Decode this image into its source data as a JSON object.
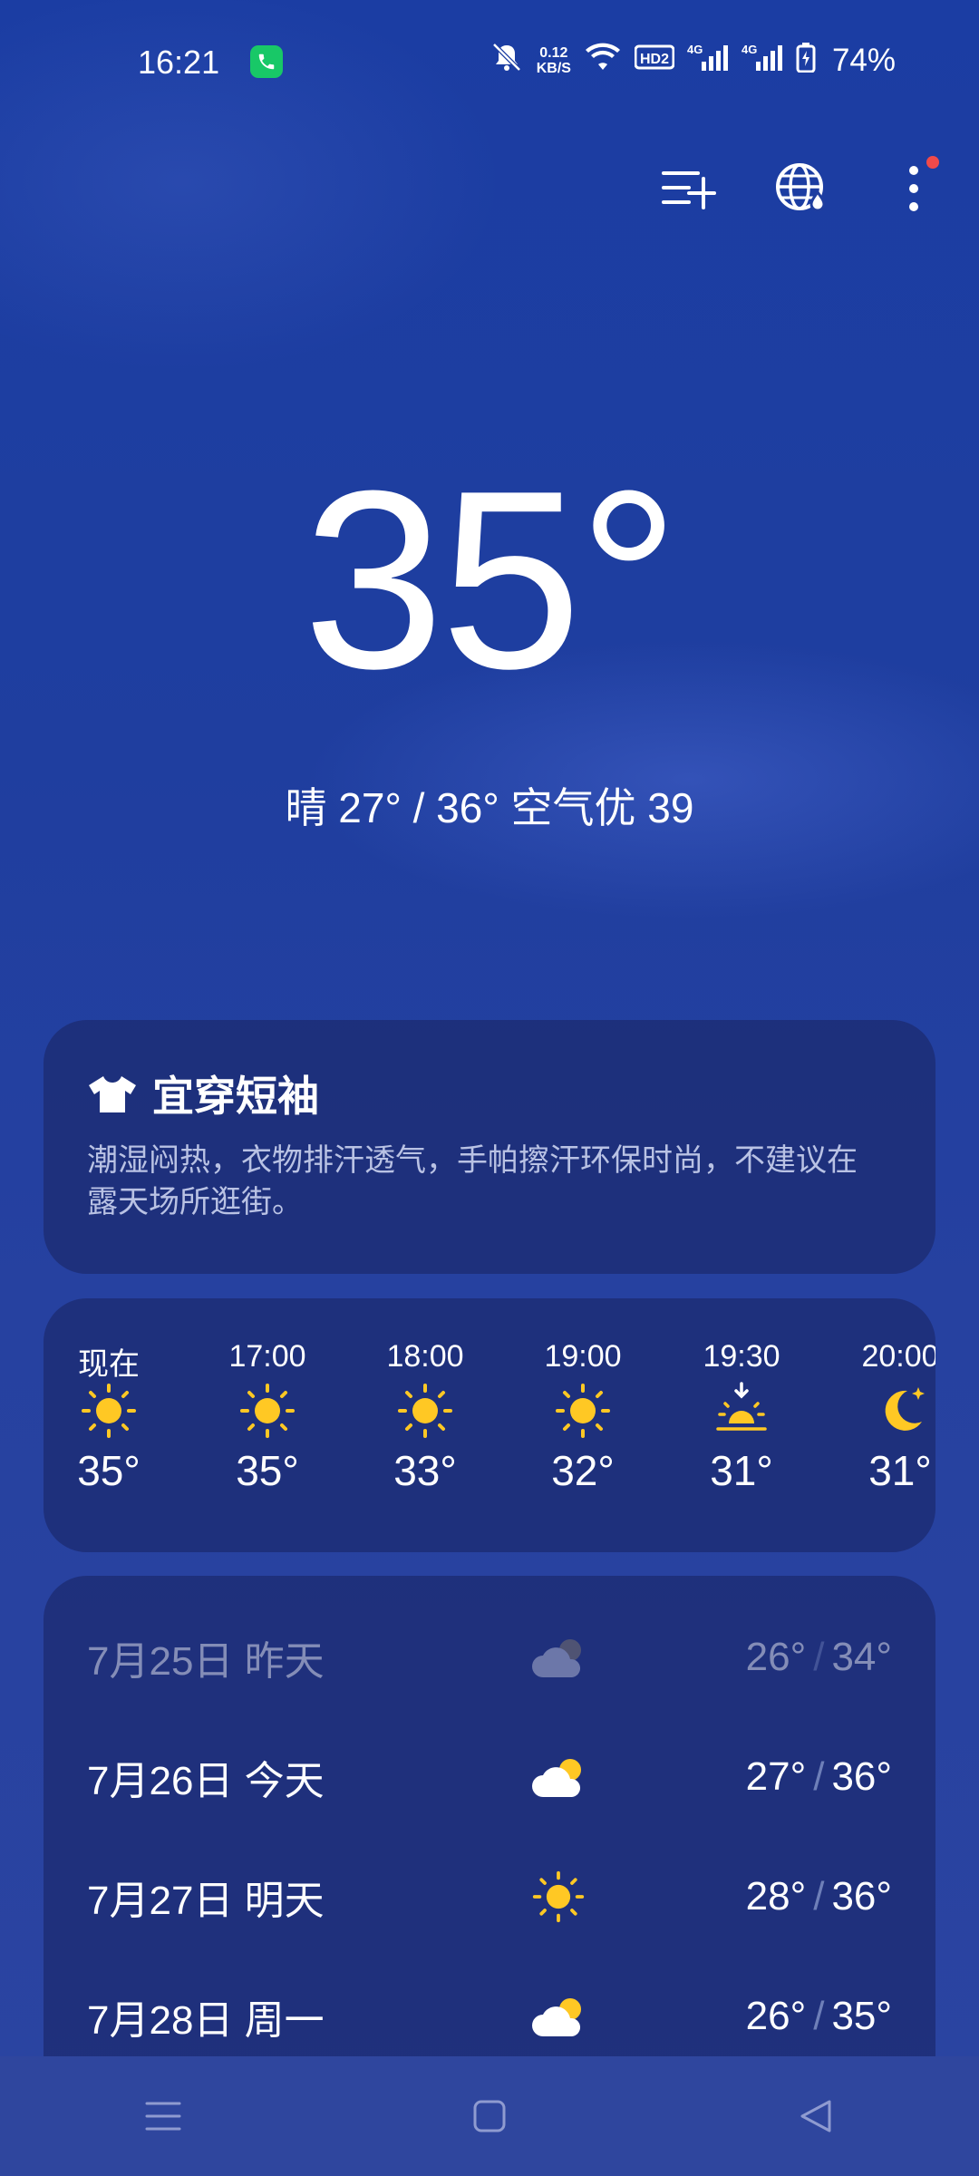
{
  "status_bar": {
    "time": "16:21",
    "net_speed_value": "0.12",
    "net_speed_unit": "KB/S",
    "hd_label": "HD2",
    "sim1_label": "4G",
    "sim2_label": "4G",
    "battery": "74%"
  },
  "current": {
    "temperature": "35°",
    "summary": "晴  27° / 36°  空气优 39"
  },
  "advice": {
    "title": "宜穿短袖",
    "text": "潮湿闷热，衣物排汗透气，手帕擦汗环保时尚，不建议在露天场所逛街。"
  },
  "hourly": [
    {
      "time": "现在",
      "icon": "sun-icon",
      "temp": "35°"
    },
    {
      "time": "17:00",
      "icon": "sun-icon",
      "temp": "35°"
    },
    {
      "time": "18:00",
      "icon": "sun-icon",
      "temp": "33°"
    },
    {
      "time": "19:00",
      "icon": "sun-icon",
      "temp": "32°"
    },
    {
      "time": "19:30",
      "icon": "sunset-icon",
      "temp": "31°"
    },
    {
      "time": "20:00",
      "icon": "moon-icon",
      "temp": "31°"
    }
  ],
  "daily": [
    {
      "label": "7月25日  昨天",
      "icon": "cloudy-icon",
      "low": "26°",
      "high": "34°"
    },
    {
      "label": "7月26日  今天",
      "icon": "cloudy-icon",
      "low": "27°",
      "high": "36°"
    },
    {
      "label": "7月27日  明天",
      "icon": "sun-icon",
      "low": "28°",
      "high": "36°"
    },
    {
      "label": "7月28日  周一",
      "icon": "cloudy-icon",
      "low": "26°",
      "high": "35°"
    }
  ],
  "colors": {
    "sun": "#ffc824",
    "phone_badge": "#18c867",
    "notification_dot": "#f04a4a"
  }
}
